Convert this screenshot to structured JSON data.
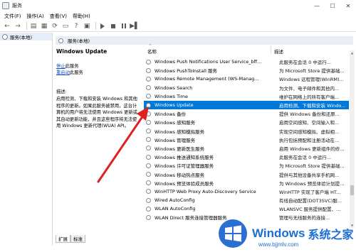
{
  "window": {
    "title": "服务",
    "min": "—",
    "max": "☐",
    "close": "✕"
  },
  "menu": [
    "文件(F)",
    "操作(A)",
    "查看(V)",
    "帮助(H)"
  ],
  "tree": {
    "root_label": "服务(本地)"
  },
  "panel": {
    "header": "服务(本地)"
  },
  "detail": {
    "title": "Windows Update",
    "stop_link": "停止",
    "stop_suffix": "此服务",
    "restart_link": "重启动",
    "restart_suffix": "此服务",
    "desc_label": "描述:",
    "desc_body": "启用检测、下载和安装 Windows 和其他程序的更新。如果此服务被禁用，这台计算机的用户将无法使用 Windows 更新或其自动更新功能，并且这些程序将无法使用 Windows 更新代理(WUA) API。"
  },
  "list": {
    "col_name": "名称",
    "col_desc": "描述",
    "sort_caret": "^",
    "rows": [
      {
        "name": "Windows Push Notifications User Service_bff...",
        "desc": "此服务在会话 0 中运行..."
      },
      {
        "name": "Windows PushToInstall 服务",
        "desc": "为 Microsoft Store 提供基础..."
      },
      {
        "name": "Windows Remote Management (WS-Manag...",
        "desc": "Windows 远程管理(WinRM)..."
      },
      {
        "name": "Windows Search",
        "desc": "为文件、电子邮件和其他内..."
      },
      {
        "name": "Windows Time",
        "desc": "维护在网络上的所有客户端..."
      },
      {
        "name": "Windows Update",
        "desc": "启用检测、下载和安装 Windo...",
        "selected": true
      },
      {
        "name": "Windows 备份",
        "desc": "提供 Windows 备份和还原..."
      },
      {
        "name": "Windows 感知服务",
        "desc": "启用空间感知、空间输入和..."
      },
      {
        "name": "Windows 感知模拟服务",
        "desc": "实现空间感知模拟、虚拟相..."
      },
      {
        "name": "Windows 管理服务",
        "desc": "执行包括预配和注册活动在..."
      },
      {
        "name": "Windows 更新医生服务",
        "desc": "启用 Windows 更新组件的修..."
      },
      {
        "name": "Windows 推送通知系统服务",
        "desc": "此服务在会话 0 中运行..."
      },
      {
        "name": "Windows 许可证管理器服务",
        "desc": "为 Microsoft Store 提供基础..."
      },
      {
        "name": "Windows 移动热点服务",
        "desc": "提供与其他设备共享手机网..."
      },
      {
        "name": "Windows 预览体验成员服务",
        "desc": "为 Windows 预览体验计划提..."
      },
      {
        "name": "WinHTTP Web Proxy Auto-Discovery Service",
        "desc": "WinHTTP 实现了客户端 HT..."
      },
      {
        "name": "Wired AutoConfig",
        "desc": "有线自动配置(DOT3SVC)服..."
      },
      {
        "name": "WLAN AutoConfig",
        "desc": "WLANSVC 服务提供配置、..."
      },
      {
        "name": "WLAN Direct 服务连接管理器服务",
        "desc": "管理与无线服务的连接..."
      }
    ]
  },
  "tabs": [
    "扩展",
    "标准"
  ],
  "watermark": {
    "logo_text": "Windows",
    "cn_text": "系统之家",
    "url": "www.bjjmlv.com"
  },
  "colors": {
    "selection": "#0078d7",
    "link": "#1a50b4",
    "arrow": "#e02020"
  }
}
